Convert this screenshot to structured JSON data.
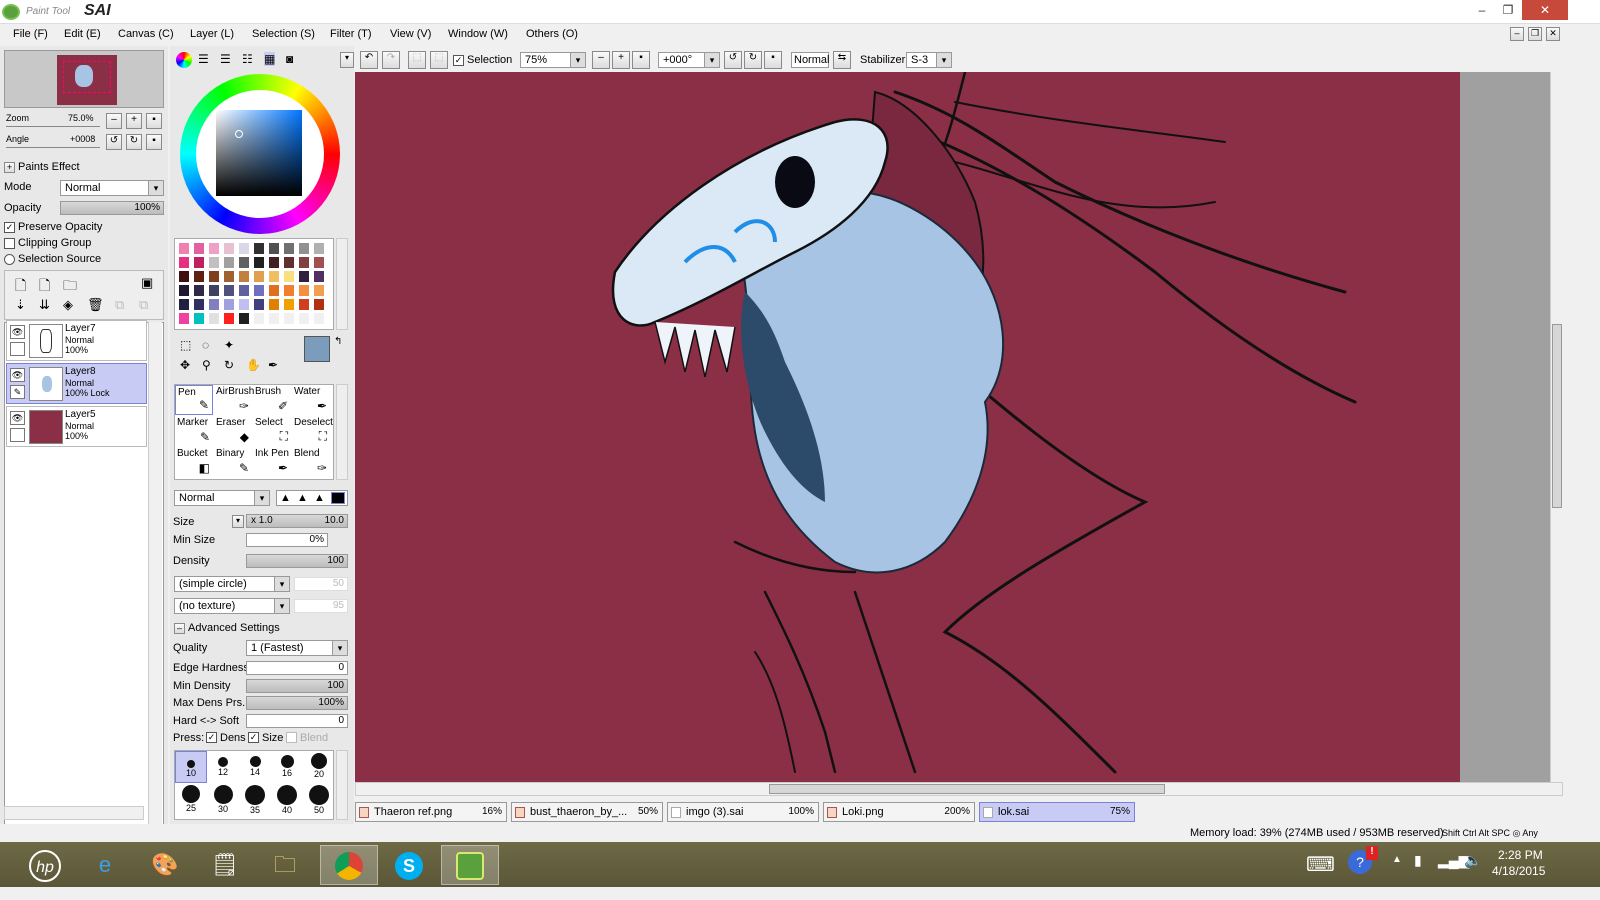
{
  "app": {
    "title_small": "Paint Tool",
    "title_big": "SAI"
  },
  "window_controls": {
    "min": "–",
    "max": "❐",
    "close": "✕"
  },
  "menu": [
    "File (F)",
    "Edit (E)",
    "Canvas (C)",
    "Layer (L)",
    "Selection (S)",
    "Filter (T)",
    "View (V)",
    "Window (W)",
    "Others (O)"
  ],
  "navigator": {
    "zoom_label": "Zoom",
    "zoom_value": "75.0%",
    "angle_label": "Angle",
    "angle_value": "+0008"
  },
  "paints_effect": "Paints Effect",
  "layer_props": {
    "mode_label": "Mode",
    "mode_value": "Normal",
    "opacity_label": "Opacity",
    "opacity_value": "100%",
    "preserve": "Preserve Opacity",
    "clipping": "Clipping Group",
    "selection_source": "Selection Source"
  },
  "layers": [
    {
      "name": "Layer7",
      "mode": "Normal",
      "opacity": "100%"
    },
    {
      "name": "Layer8",
      "mode": "Normal",
      "opacity": "100% Lock"
    },
    {
      "name": "Layer5",
      "mode": "Normal",
      "opacity": "100%",
      "color": "#8b2f47"
    }
  ],
  "toolbar": {
    "selection_label": "Selection",
    "zoom": "75%",
    "angle": "+000°",
    "blend": "Normal",
    "stabilizer_label": "Stabilizer",
    "stabilizer_value": "S-3"
  },
  "tools": [
    {
      "name": "Pen",
      "icon": "pen-icon",
      "glyph": "✎"
    },
    {
      "name": "AirBrush",
      "icon": "airbrush-icon",
      "glyph": "✑"
    },
    {
      "name": "Brush",
      "icon": "brush-icon",
      "glyph": "✐"
    },
    {
      "name": "Water",
      "icon": "water-icon",
      "glyph": "✒"
    },
    {
      "name": "Marker",
      "icon": "marker-icon",
      "glyph": "✎"
    },
    {
      "name": "Eraser",
      "icon": "eraser-icon",
      "glyph": "◆"
    },
    {
      "name": "Select",
      "icon": "select-icon",
      "glyph": "⛶"
    },
    {
      "name": "Deselect",
      "icon": "deselect-icon",
      "glyph": "⛶"
    },
    {
      "name": "Bucket",
      "icon": "bucket-icon",
      "glyph": "◧"
    },
    {
      "name": "Binary",
      "icon": "binary-icon",
      "glyph": "✎"
    },
    {
      "name": "Ink Pen",
      "icon": "inkpen-icon",
      "glyph": "✒"
    },
    {
      "name": "Blend",
      "icon": "blend-icon",
      "glyph": "✑"
    }
  ],
  "brush": {
    "mode": "Normal",
    "size_label": "Size",
    "size_mult": "x 1.0",
    "size_value": "10.0",
    "minsize_label": "Min Size",
    "minsize_value": "0%",
    "density_label": "Density",
    "density_value": "100",
    "shape": "(simple circle)",
    "shape_val": "50",
    "texture": "(no texture)",
    "texture_val": "95",
    "advanced": "Advanced Settings",
    "quality_label": "Quality",
    "quality_value": "1 (Fastest)",
    "edge_label": "Edge Hardness",
    "edge_value": "0",
    "mindens_label": "Min Density",
    "mindens_value": "100",
    "maxdens_label": "Max Dens Prs.",
    "maxdens_value": "100%",
    "hardsoft_label": "Hard <-> Soft",
    "hardsoft_value": "0",
    "press_label": "Press:",
    "press_dens": "Dens",
    "press_size": "Size",
    "press_blend": "Blend"
  },
  "brush_sizes": [
    "10",
    "12",
    "14",
    "16",
    "20",
    "25",
    "30",
    "35",
    "40",
    "50"
  ],
  "tabs": [
    {
      "name": "Thaeron ref.png",
      "pct": "16%"
    },
    {
      "name": "bust_thaeron_by_...",
      "pct": "50%"
    },
    {
      "name": "imgo (3).sai",
      "pct": "100%"
    },
    {
      "name": "Loki.png",
      "pct": "200%"
    },
    {
      "name": "lok.sai",
      "pct": "75%"
    }
  ],
  "status": {
    "memory": "Memory load: 39% (274MB used / 953MB reserved)",
    "keys": "Shift Ctrl Alt SPC ◎ Any"
  },
  "taskbar": {
    "time": "2:28 PM",
    "date": "4/18/2015",
    "apps": [
      "hp-icon",
      "ie-icon",
      "paint-icon",
      "notepad-icon",
      "explorer-icon",
      "chrome-icon",
      "skype-icon",
      "sai-icon"
    ]
  },
  "colors": {
    "canvas_bg": "#8b2f47",
    "accent_sel": "#c8cbf4",
    "hair": "#a8c4e4",
    "close": "#c7493b"
  }
}
